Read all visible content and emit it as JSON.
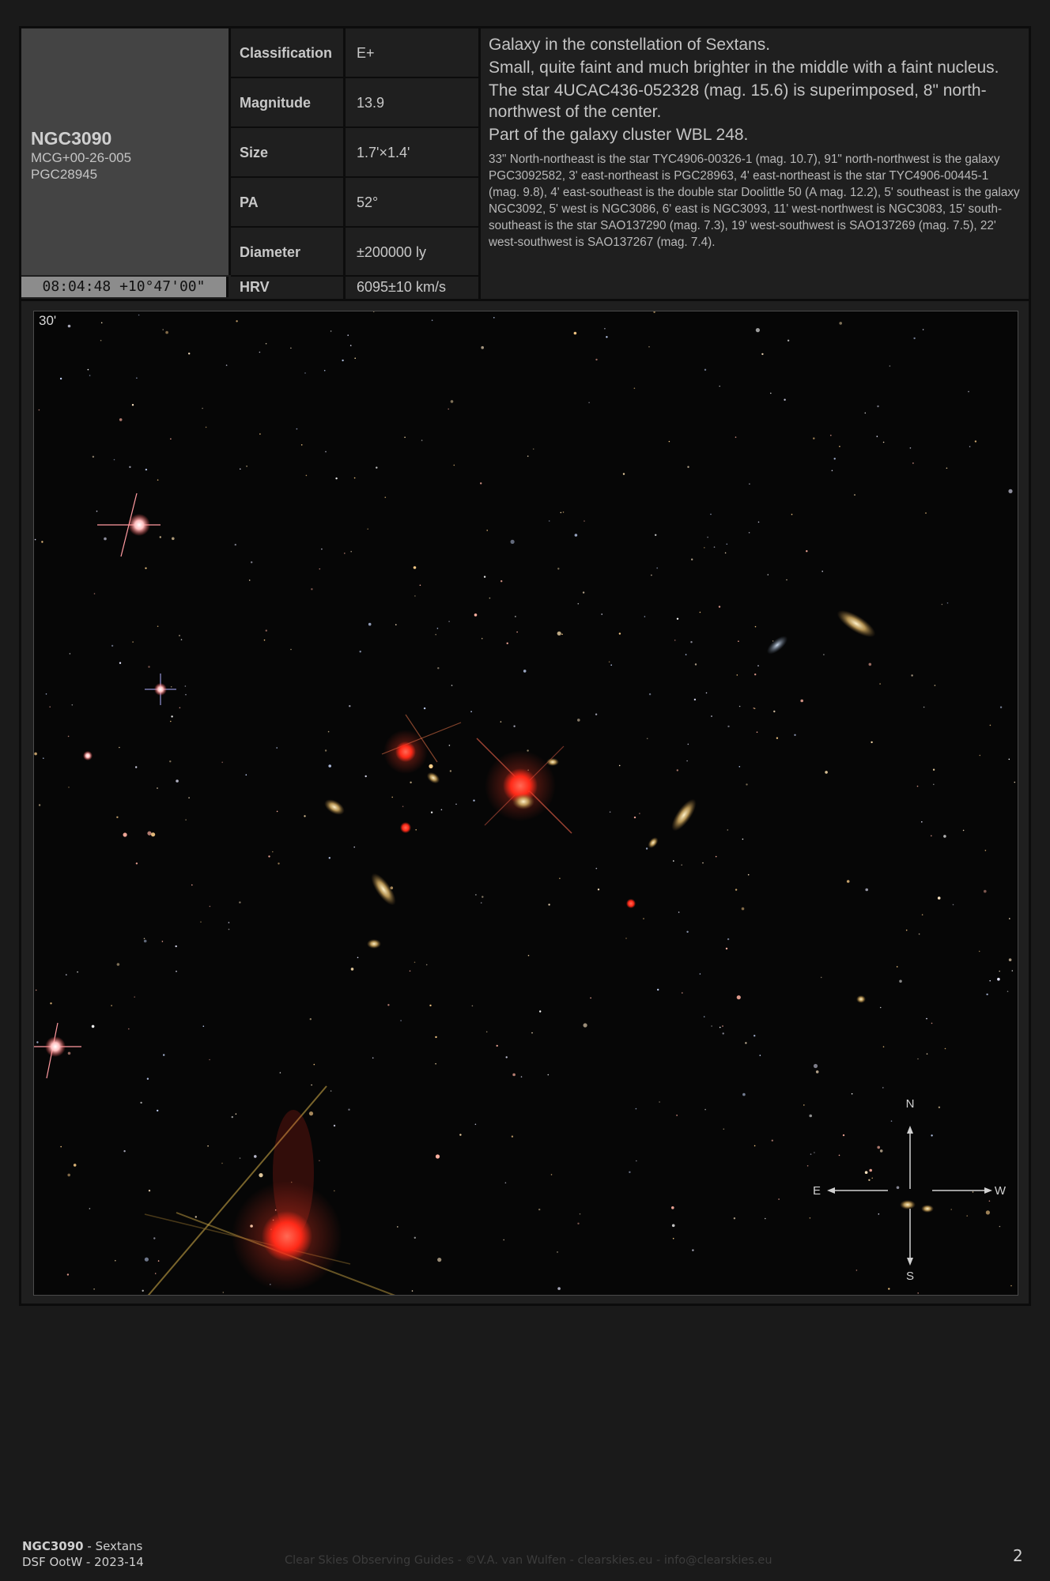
{
  "object": {
    "name": "NGC3090",
    "alt_designations": [
      "MCG+00-26-005",
      "PGC28945"
    ],
    "coordinates": "08:04:48 +10°47'00\""
  },
  "properties": [
    {
      "label": "Classification",
      "value": "E+"
    },
    {
      "label": "Magnitude",
      "value": "13.9"
    },
    {
      "label": "Size",
      "value": "1.7'×1.4'"
    },
    {
      "label": "PA",
      "value": "52°"
    },
    {
      "label": "Diameter",
      "value": "±200000 ly"
    },
    {
      "label": "HRV",
      "value": "6095±10 km/s"
    }
  ],
  "description": {
    "main": [
      "Galaxy in the constellation of Sextans.",
      "Small, quite faint and much brighter in the middle with a faint nucleus.",
      "The star 4UCAC436-052328 (mag. 15.6) is superimposed, 8\" north-northwest of the center.",
      "Part of the galaxy cluster WBL 248."
    ],
    "detail": "33\" North-northeast is the star TYC4906-00326-1 (mag. 10.7), 91\" north-northwest is the galaxy PGC3092582, 3' east-northeast is PGC28963, 4' east-northeast is the star TYC4906-00445-1 (mag. 9.8), 4' east-southeast is the double star Doolittle 50 (A mag. 12.2), 5' southeast is the galaxy NGC3092, 5' west is NGC3086, 6' east is NGC3093, 11' west-northwest is NGC3083, 15' south-southeast is the star SAO137290 (mag. 7.3), 19' west-southwest is SAO137269 (mag. 7.5), 22' west-southwest is SAO137267 (mag. 7.4)."
  },
  "image": {
    "scale_label": "30'",
    "compass": {
      "north": "N",
      "south": "S",
      "east": "E",
      "west": "W"
    }
  },
  "footer": {
    "object": "NGC3090",
    "constellation": " - Sextans",
    "edition": "DSF OotW - 2023-14",
    "credit": "Clear Skies Observing Guides - ©V.A. van Wulfen - clearskies.eu - info@clearskies.eu",
    "page": "2"
  }
}
